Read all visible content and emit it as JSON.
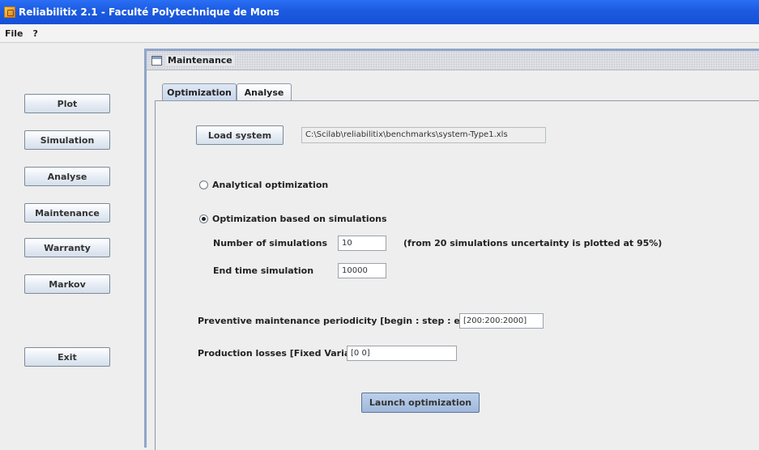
{
  "window": {
    "title": "Reliabilitix 2.1 - Faculté Polytechnique de Mons"
  },
  "menu": {
    "items": [
      "File",
      "?"
    ]
  },
  "sidebar": {
    "buttons": [
      "Plot",
      "Simulation",
      "Analyse",
      "Maintenance",
      "Warranty",
      "Markov",
      "Exit"
    ]
  },
  "frame": {
    "title": "Maintenance",
    "tabs": [
      "Optimization",
      "Analyse"
    ],
    "active_tab": "Optimization"
  },
  "optimization": {
    "load_button": "Load system",
    "system_path": "C:\\Scilab\\reliabilitix\\benchmarks\\system-Type1.xls",
    "radio_analytical": "Analytical optimization",
    "radio_simulation": "Optimization based on simulations",
    "selected_method": "Optimization based on simulations",
    "num_simulations_label": "Number of simulations",
    "num_simulations_value": "10",
    "num_simulations_note": "(from 20 simulations uncertainty is plotted at 95%)",
    "end_time_label": "End time simulation",
    "end_time_value": "10000",
    "periodicity_label": "Preventive maintenance periodicity [begin : step : end]",
    "periodicity_value": "[200:200:2000]",
    "production_losses_label": "Production losses [Fixed Variable]",
    "production_losses_value": "[0 0]",
    "launch_button": "Launch optimization"
  }
}
